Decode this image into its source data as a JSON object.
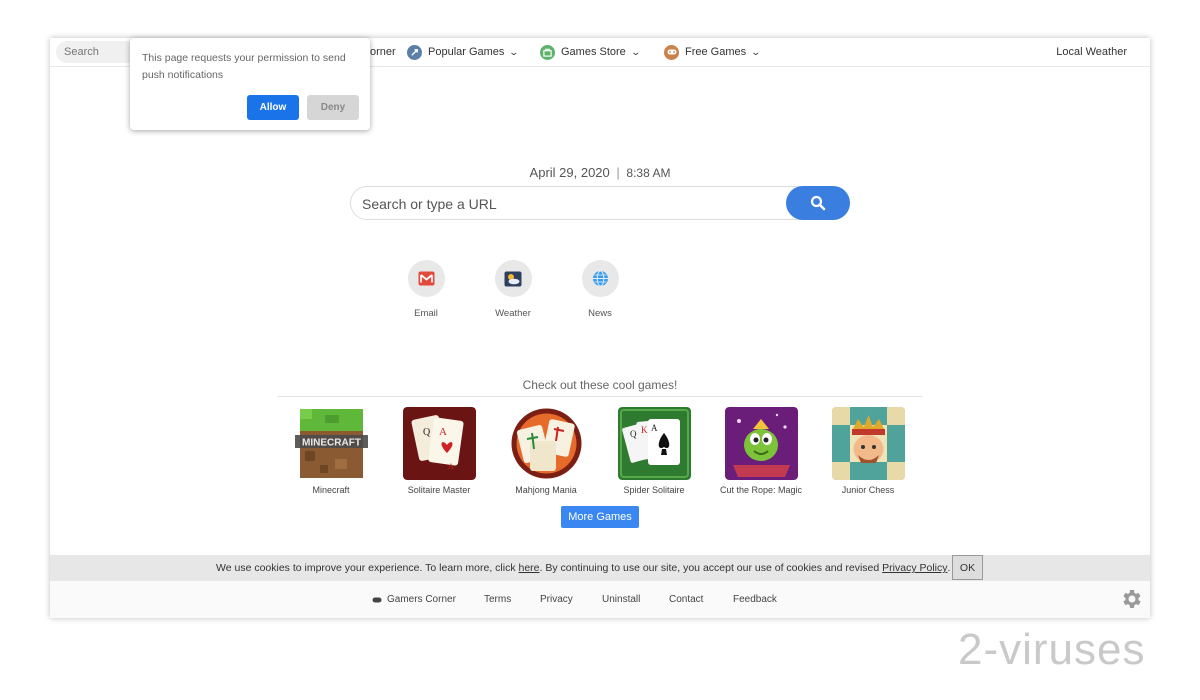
{
  "nav": {
    "search_placeholder": "Search",
    "partial_item": "orner",
    "items": [
      {
        "label": "Popular Games",
        "icon": "rocket-icon"
      },
      {
        "label": "Games Store",
        "icon": "store-icon"
      },
      {
        "label": "Free Games",
        "icon": "gamepad-icon"
      }
    ],
    "right_label": "Local Weather"
  },
  "notification": {
    "text": "This page requests your permission to send push notifications",
    "allow": "Allow",
    "deny": "Deny"
  },
  "datetime": {
    "date": "April 29, 2020",
    "separator": "|",
    "time": "8:38 AM"
  },
  "search": {
    "placeholder": "Search or type a URL"
  },
  "quick_links": [
    {
      "label": "Email",
      "icon": "gmail-icon"
    },
    {
      "label": "Weather",
      "icon": "weather-icon"
    },
    {
      "label": "News",
      "icon": "globe-icon"
    }
  ],
  "games": {
    "title": "Check out these cool games!",
    "items": [
      {
        "label": "Minecraft"
      },
      {
        "label": "Solitaire Master"
      },
      {
        "label": "Mahjong Mania"
      },
      {
        "label": "Spider Solitaire"
      },
      {
        "label": "Cut the Rope: Magic"
      },
      {
        "label": "Junior Chess"
      }
    ],
    "more_label": "More Games",
    "minecraft_logo": "MINECRAFT"
  },
  "cookie": {
    "text_1": "We use cookies to improve your experience. To learn more, click ",
    "link_here": "here",
    "text_2": ". By continuing to use our site, you accept our use of cookies and revised ",
    "link_policy": "Privacy Policy",
    "text_3": ".",
    "ok": "OK"
  },
  "footer": {
    "links": [
      "Gamers Corner",
      "Terms",
      "Privacy",
      "Uninstall",
      "Contact",
      "Feedback"
    ]
  },
  "watermark": "2-viruses"
}
